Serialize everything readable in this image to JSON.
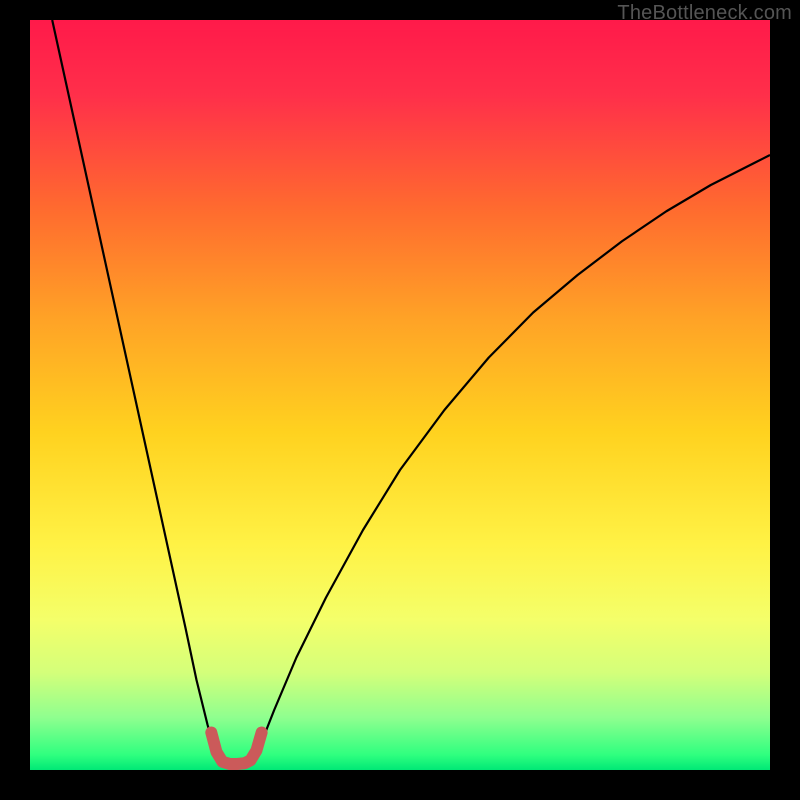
{
  "watermark": "TheBottleneck.com",
  "chart_data": {
    "type": "line",
    "title": "",
    "xlabel": "",
    "ylabel": "",
    "xlim": [
      0,
      100
    ],
    "ylim": [
      0,
      100
    ],
    "grid": false,
    "gradient_stops": [
      {
        "offset": 0.0,
        "color": "#ff1a4a"
      },
      {
        "offset": 0.1,
        "color": "#ff2f4a"
      },
      {
        "offset": 0.25,
        "color": "#ff6a2f"
      },
      {
        "offset": 0.4,
        "color": "#ffa326"
      },
      {
        "offset": 0.55,
        "color": "#ffd21f"
      },
      {
        "offset": 0.7,
        "color": "#fff245"
      },
      {
        "offset": 0.8,
        "color": "#f4ff6a"
      },
      {
        "offset": 0.87,
        "color": "#d4ff7a"
      },
      {
        "offset": 0.93,
        "color": "#8fff8f"
      },
      {
        "offset": 0.98,
        "color": "#2fff7f"
      },
      {
        "offset": 1.0,
        "color": "#00e876"
      }
    ],
    "series": [
      {
        "name": "curve-left",
        "color": "#000000",
        "width": 2.2,
        "x": [
          3,
          5,
          7,
          9,
          11,
          13,
          15,
          17,
          19,
          21,
          22.5,
          24,
          25,
          25.7
        ],
        "y": [
          100,
          91,
          82,
          73,
          64,
          55,
          46,
          37,
          28,
          19,
          12,
          6,
          2.5,
          1
        ]
      },
      {
        "name": "curve-right",
        "color": "#000000",
        "width": 2.2,
        "x": [
          30,
          31,
          33,
          36,
          40,
          45,
          50,
          56,
          62,
          68,
          74,
          80,
          86,
          92,
          98,
          100
        ],
        "y": [
          1,
          3,
          8,
          15,
          23,
          32,
          40,
          48,
          55,
          61,
          66,
          70.5,
          74.5,
          78,
          81,
          82
        ]
      },
      {
        "name": "marker-lobe",
        "color": "#cb5a5a",
        "width": 12,
        "linecap": "round",
        "x": [
          24.5,
          25.2,
          26,
          27,
          28,
          29,
          29.8,
          30.6,
          31.3
        ],
        "y": [
          5,
          2.4,
          1.1,
          0.8,
          0.8,
          0.9,
          1.3,
          2.6,
          5
        ]
      }
    ]
  }
}
